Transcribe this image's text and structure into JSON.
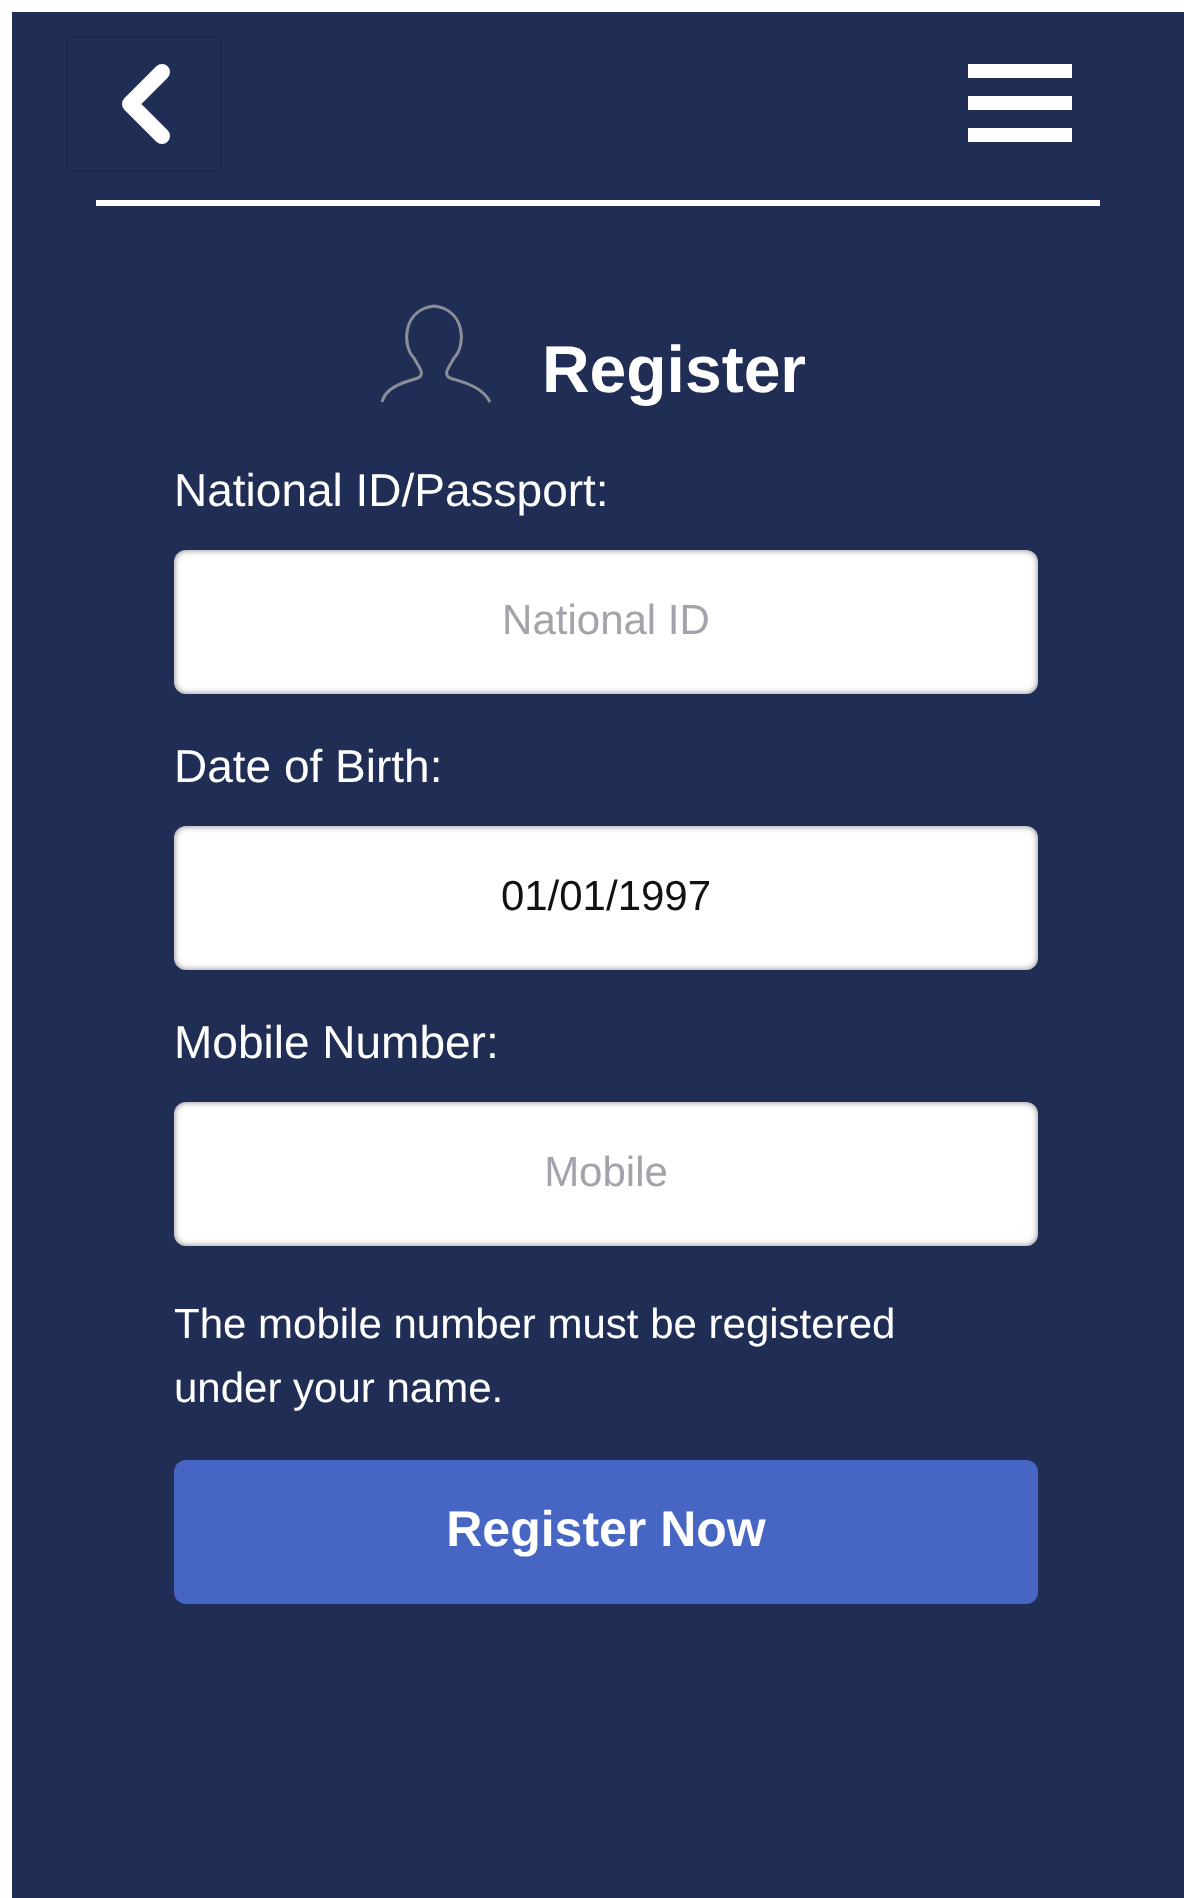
{
  "title": "Register",
  "fields": [
    {
      "label": "National ID/Passport:",
      "placeholder": "National ID"
    },
    {
      "label": "Date of Birth:",
      "value": "01/01/1997"
    },
    {
      "label": "Mobile Number:",
      "placeholder": "Mobile"
    }
  ],
  "note": "The mobile number must be registered under your name.",
  "submit": "Register Now"
}
